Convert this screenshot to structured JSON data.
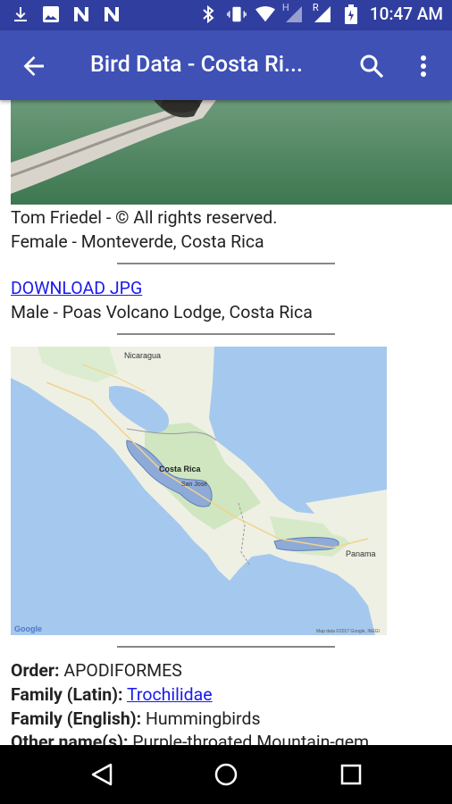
{
  "status": {
    "time": "10:47 AM",
    "network_letter_h": "H",
    "network_letter_r": "R"
  },
  "appbar": {
    "title": "Bird Data - Costa Ri..."
  },
  "photo": {
    "credit": "Tom Friedel - © All rights reserved."
  },
  "captions": {
    "female": "Female - Monteverde, Costa Rica",
    "download": "DOWNLOAD JPG",
    "male": "Male - Poas Volcano Lodge, Costa Rica"
  },
  "map": {
    "labels": {
      "nicaragua": "Nicaragua",
      "costa_rica": "Costa Rica",
      "panama": "Panama",
      "san_jose": "San José"
    },
    "google": "Google",
    "attribution": "Map data ©2017 Google, INEGI"
  },
  "info": {
    "order_label": "Order:",
    "order_value": "APODIFORMES",
    "family_latin_label": "Family (Latin):",
    "family_latin_value": "Trochilidae",
    "family_english_label": "Family (English):",
    "family_english_value": "Hummingbirds",
    "other_names_label": "Other name(s):",
    "other_names_value": "Purple-throated Mountain-gem"
  },
  "colors": {
    "primary": "#3F51B5",
    "primary_dark": "#303F9F",
    "link": "#1a1aee"
  }
}
